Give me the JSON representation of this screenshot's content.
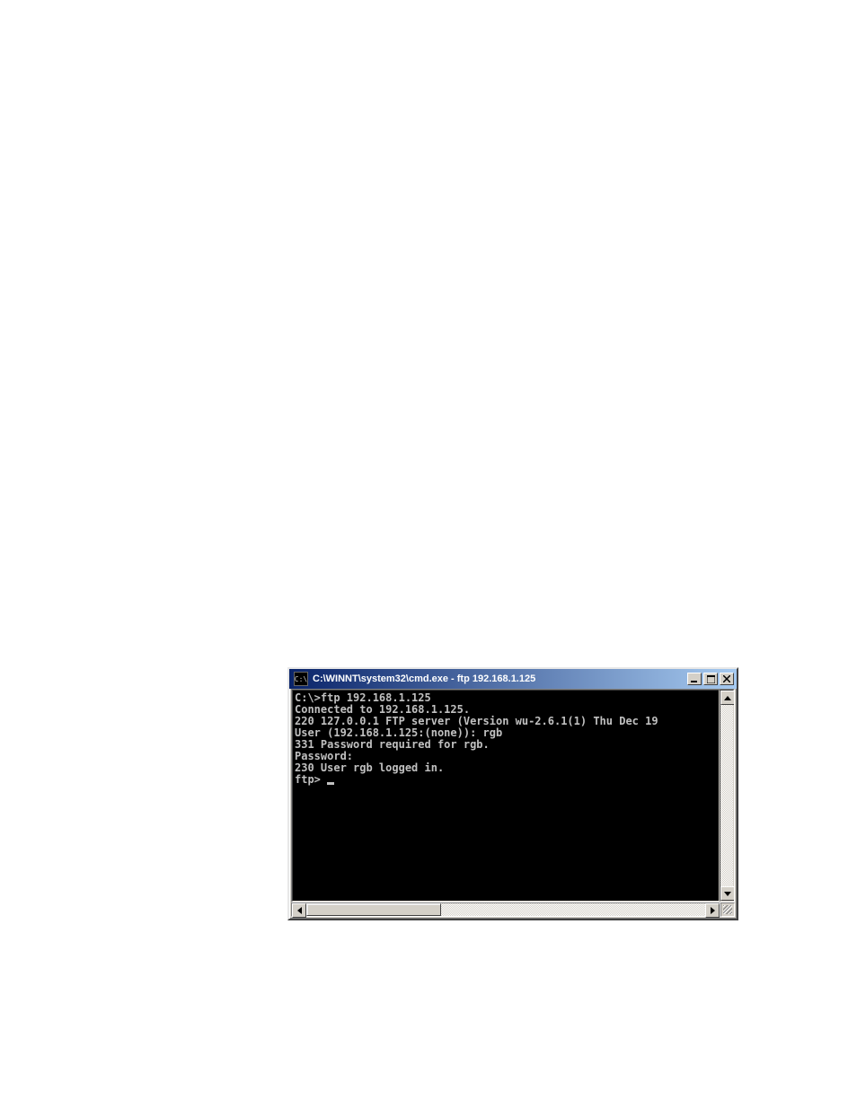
{
  "window": {
    "title": "C:\\WINNT\\system32\\cmd.exe - ftp 192.168.1.125",
    "icon_label": "cmd-icon"
  },
  "terminal": {
    "lines": [
      "",
      "C:\\>ftp 192.168.1.125",
      "Connected to 192.168.1.125.",
      "220 127.0.0.1 FTP server (Version wu-2.6.1(1) Thu Dec 19",
      "User (192.168.1.125:(none)): rgb",
      "331 Password required for rgb.",
      "Password:",
      "230 User rgb logged in.",
      "ftp> "
    ]
  }
}
